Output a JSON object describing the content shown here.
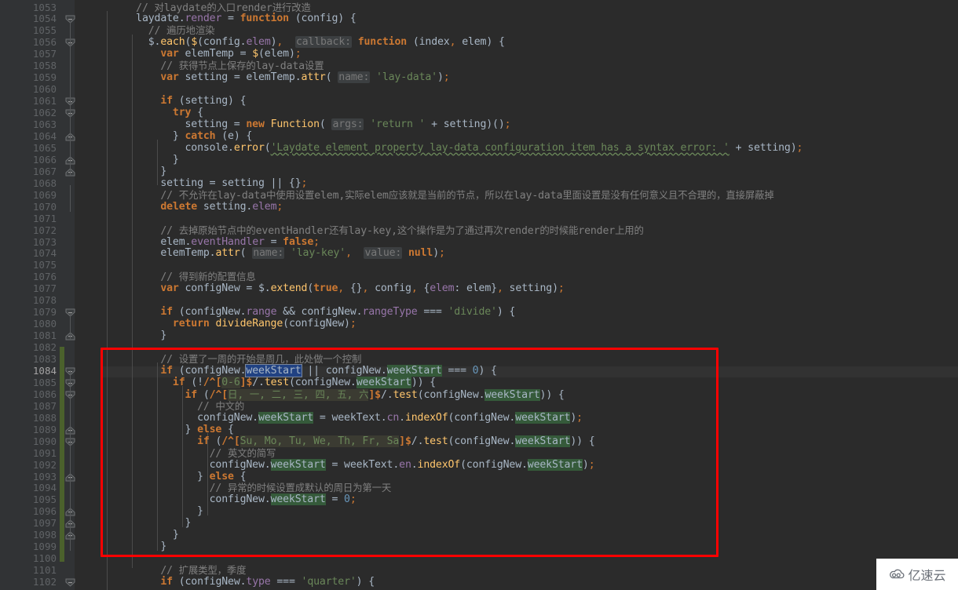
{
  "editor": {
    "theme": "darcula",
    "background": "#2b2b2b",
    "gutter_background": "#313335",
    "accent_annotation_color": "#ff0000",
    "usage_highlight_color": "#355a3a",
    "selection_highlight_color": "#214283",
    "vcs_modified_color": "#4b612c",
    "current_line_number": "1084",
    "first_line_number": 1053,
    "last_line_number": 1102
  },
  "watermark": {
    "text": "亿速云",
    "icon": "cloud-icon"
  },
  "code_lines": [
    {
      "n": "1053",
      "text": "    // 对laydate的入口render进行改造"
    },
    {
      "n": "1054",
      "text": "    laydate.render = function (config) {"
    },
    {
      "n": "1055",
      "text": "      // 遍历地渲染"
    },
    {
      "n": "1056",
      "text": "      $.each($(config.elem),  callback: function (index, elem) {"
    },
    {
      "n": "1057",
      "text": "        var elemTemp = $(elem);"
    },
    {
      "n": "1058",
      "text": "        // 获得节点上保存的lay-data设置"
    },
    {
      "n": "1059",
      "text": "        var setting = elemTemp.attr( name: 'lay-data');"
    },
    {
      "n": "1060",
      "text": ""
    },
    {
      "n": "1061",
      "text": "        if (setting) {"
    },
    {
      "n": "1062",
      "text": "          try {"
    },
    {
      "n": "1063",
      "text": "            setting = new Function( args: 'return ' + setting)();"
    },
    {
      "n": "1064",
      "text": "          } catch (e) {"
    },
    {
      "n": "1065",
      "text": "            console.error('Laydate element property lay-data configuration item has a syntax error: ' + setting);"
    },
    {
      "n": "1066",
      "text": "          }"
    },
    {
      "n": "1067",
      "text": "        }"
    },
    {
      "n": "1068",
      "text": "        setting = setting || {};"
    },
    {
      "n": "1069",
      "text": "        // 不允许在lay-data中使用设置elem,实际elem应该就是当前的节点，所以在lay-data里面设置是没有任何意义且不合理的，直接屏蔽掉"
    },
    {
      "n": "1070",
      "text": "        delete setting.elem;"
    },
    {
      "n": "1071",
      "text": ""
    },
    {
      "n": "1072",
      "text": "        // 去掉原始节点中的eventHandler还有lay-key,这个操作是为了通过再次render的时候能render上用的"
    },
    {
      "n": "1073",
      "text": "        elem.eventHandler = false;"
    },
    {
      "n": "1074",
      "text": "        elemTemp.attr( name: 'lay-key',  value: null);"
    },
    {
      "n": "1075",
      "text": ""
    },
    {
      "n": "1076",
      "text": "        // 得到新的配置信息"
    },
    {
      "n": "1077",
      "text": "        var configNew = $.extend(true, {}, config, {elem: elem}, setting);"
    },
    {
      "n": "1078",
      "text": ""
    },
    {
      "n": "1079",
      "text": "        if (configNew.range && configNew.rangeType === 'divide') {"
    },
    {
      "n": "1080",
      "text": "          return divideRange(configNew);"
    },
    {
      "n": "1081",
      "text": "        }"
    },
    {
      "n": "1082",
      "text": ""
    },
    {
      "n": "1083",
      "text": "        // 设置了一周的开始是周几，此处做一个控制"
    },
    {
      "n": "1084",
      "text": "        if (configNew.weekStart || configNew.weekStart === 0) {"
    },
    {
      "n": "1085",
      "text": "          if (!/^[0-6]$/.test(configNew.weekStart)) {"
    },
    {
      "n": "1086",
      "text": "            if (/^[日, 一, 二, 三, 四, 五, 六]$/.test(configNew.weekStart)) {"
    },
    {
      "n": "1087",
      "text": "              // 中文的"
    },
    {
      "n": "1088",
      "text": "              configNew.weekStart = weekText.cn.indexOf(configNew.weekStart);"
    },
    {
      "n": "1089",
      "text": "            } else {"
    },
    {
      "n": "1090",
      "text": "              if (/^[Su, Mo, Tu, We, Th, Fr, Sa]$/.test(configNew.weekStart)) {"
    },
    {
      "n": "1091",
      "text": "                // 英文的简写"
    },
    {
      "n": "1092",
      "text": "                configNew.weekStart = weekText.en.indexOf(configNew.weekStart);"
    },
    {
      "n": "1093",
      "text": "              } else {"
    },
    {
      "n": "1094",
      "text": "                // 异常的时候设置成默认的周日为第一天"
    },
    {
      "n": "1095",
      "text": "                configNew.weekStart = 0;"
    },
    {
      "n": "1096",
      "text": "              }"
    },
    {
      "n": "1097",
      "text": "            }"
    },
    {
      "n": "1098",
      "text": "          }"
    },
    {
      "n": "1099",
      "text": "        }"
    },
    {
      "n": "1100",
      "text": ""
    },
    {
      "n": "1101",
      "text": "        // 扩展类型，季度"
    },
    {
      "n": "1102",
      "text": "        if (configNew.type === 'quarter') {"
    }
  ],
  "highlighted_symbol": "weekStart",
  "inlay_hints": [
    "callback:",
    "args:",
    "name:",
    "value:"
  ]
}
